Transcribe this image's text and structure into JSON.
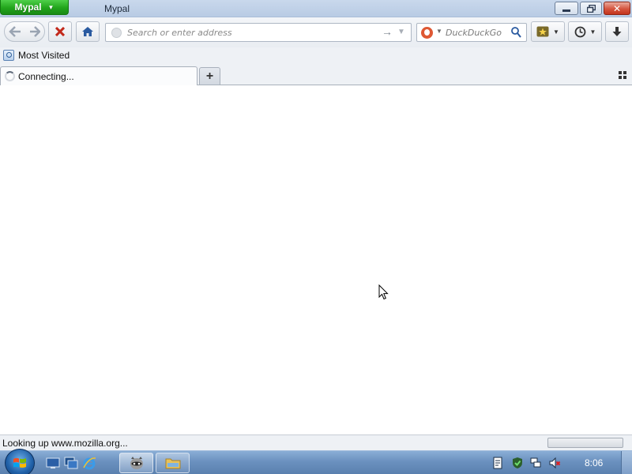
{
  "window": {
    "app_menu_label": "Mypal",
    "title": "Mypal"
  },
  "navbar": {
    "url_placeholder": "Search or enter address",
    "search_placeholder": "DuckDuckGo"
  },
  "bookmarks_bar": {
    "items": [
      {
        "label": "Most Visited"
      }
    ]
  },
  "tabs": [
    {
      "label": "Connecting...",
      "loading": true
    }
  ],
  "status": {
    "text": "Looking up www.mozilla.org..."
  },
  "taskbar": {
    "clock": "8:06"
  },
  "colors": {
    "app_menu": "#22a51c",
    "close_button": "#c2341c",
    "taskbar": "#6b91bf"
  }
}
